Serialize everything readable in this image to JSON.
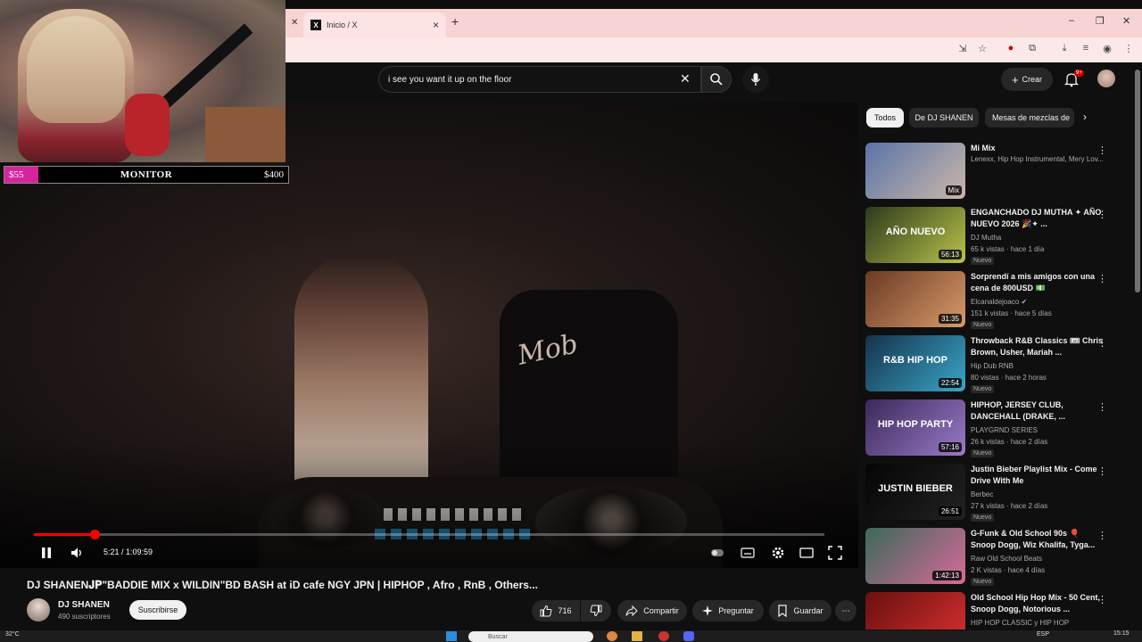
{
  "browser": {
    "tab_title": "Inicio / X",
    "tab_close": "×",
    "new_tab": "+",
    "win_min": "–",
    "win_max": "❐",
    "win_close": "✕"
  },
  "overlay": {
    "min_label": "$55",
    "center_label": "MONITOR",
    "max_label": "$400",
    "progress": 0.12,
    "fill_color": "#d6249f"
  },
  "youtube": {
    "search_value": "i see you want it up on the floor",
    "search_clear": "✕",
    "create_label": "Crear",
    "create_plus": "+",
    "notif_badge": "9+"
  },
  "player": {
    "time_label": "5:21 / 1:09:59",
    "progress_fraction": 0.0764,
    "accent": "#ff0000"
  },
  "video": {
    "title": "DJ SHANEN𝐉𝐏\"BADDIE MIX x WILDIN\"BD BASH at iD cafe NGY JPN | HIPHOP , Afro , RnB , Others...",
    "channel_name": "DJ SHANEN",
    "channel_subs": "490 suscriptores",
    "subscribe_label": "Suscribirse",
    "like_count": "716",
    "share_label": "Compartir",
    "ask_label": "Preguntar",
    "save_label": "Guardar",
    "more_label": "⋯"
  },
  "chips": [
    "Todos",
    "De DJ SHANEN",
    "Mesas de mezclas de"
  ],
  "recommendations": [
    {
      "title": "Mi Mix",
      "channel": "Lenexx, Hip Hop Instrumental, Mery Lov...",
      "meta": "",
      "badge": "",
      "duration": "Mix",
      "thumb_text": "",
      "colors": [
        "#5b74a8",
        "#c9b7a8"
      ]
    },
    {
      "title": "ENGANCHADO DJ MUTHA ✦ AÑO NUEVO 2026 🎉✦ ...",
      "channel": "DJ Mutha",
      "meta": "65 k vistas · hace 1 día",
      "badge": "Nuevo",
      "duration": "56:13",
      "thumb_text": "AÑO NUEVO",
      "colors": [
        "#2c3a1c",
        "#b9c24a"
      ]
    },
    {
      "title": "Sorprendí a mis amigos con una cena de 800USD 💵",
      "channel": "Elcanaldejoaco ✔",
      "meta": "151 k vistas · hace 5 días",
      "badge": "Nuevo",
      "duration": "31:35",
      "thumb_text": "",
      "colors": [
        "#6a3a24",
        "#d89a6a"
      ]
    },
    {
      "title": "Throwback R&B Classics 🎟 Chris Brown, Usher, Mariah ...",
      "channel": "Hip Dub RNB",
      "meta": "80 vistas · hace 2 horas",
      "badge": "Nuevo",
      "duration": "22:54",
      "thumb_text": "R&B HIP HOP",
      "colors": [
        "#14324a",
        "#3aa6c8"
      ]
    },
    {
      "title": "HIPHOP, JERSEY CLUB, DANCEHALL (DRAKE, ...",
      "channel": "PLAYGRND SERIES",
      "meta": "26 k vistas · hace 2 días",
      "badge": "Nuevo",
      "duration": "57:16",
      "thumb_text": "HIP HOP PARTY",
      "colors": [
        "#3a2a5a",
        "#9a7ac8"
      ]
    },
    {
      "title": "Justin Bieber Playlist Mix - Come Drive With Me",
      "channel": "Berbec",
      "meta": "27 k vistas · hace 2 días",
      "badge": "Nuevo",
      "duration": "26:51",
      "thumb_text": "JUSTIN BIEBER",
      "colors": [
        "#050505",
        "#222222"
      ]
    },
    {
      "title": "G-Funk & Old School 90s 🎈 Snoop Dogg, Wiz Khalifa, Tyga...",
      "channel": "Raw Old School Beats",
      "meta": "2 K vistas · hace 4 días",
      "badge": "Nuevo",
      "duration": "1:42:13",
      "thumb_text": "",
      "colors": [
        "#3a6a5a",
        "#d86a9a"
      ]
    },
    {
      "title": "Old School Hip Hop Mix - 50 Cent, Snoop Dogg, Notorious ...",
      "channel": "HIP HOP CLASSIC y HIP HOP",
      "meta": "",
      "badge": "",
      "duration": "",
      "thumb_text": "",
      "colors": [
        "#6a1010",
        "#d83030"
      ]
    }
  ],
  "taskbar": {
    "weather": "32°C",
    "search_placeholder": "Buscar",
    "lang": "ESP",
    "time": "15:15"
  },
  "icons": [
    "search-icon",
    "mic-icon",
    "bell-icon",
    "pause-icon",
    "volume-icon",
    "settings-icon",
    "fullscreen-icon",
    "like-icon",
    "dislike-icon",
    "share-icon",
    "sparkle-icon",
    "bookmark-icon",
    "more-vert-icon"
  ]
}
